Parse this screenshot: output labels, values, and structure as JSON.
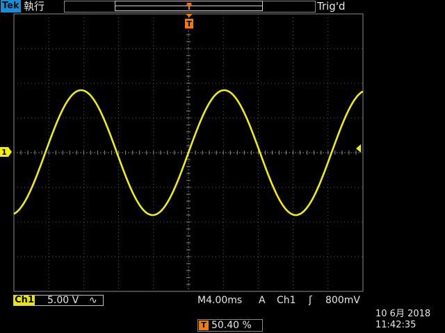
{
  "header": {
    "logo": "Tek",
    "run_status": "執行",
    "trigger_status": "Trig'd",
    "trigger_marker_top": "T",
    "trigger_marker_sub": "T"
  },
  "channel1": {
    "marker": "1",
    "label": "Ch1",
    "scale": "5.00 V",
    "coupling_icon": "∿",
    "color": "#f0f000"
  },
  "horizontal": {
    "timebase": "M4.00ms"
  },
  "trigger": {
    "mode": "A",
    "source": "Ch1",
    "slope_icon": "ʃ",
    "level": "800mV",
    "position_icon": "T",
    "position": "50.40 %",
    "marker_color": "#f07a10"
  },
  "clock": {
    "date": "10 6月  2018",
    "time": "11:42:35"
  },
  "waveform": {
    "type": "sine",
    "amplitude_divisions": 1.8,
    "period_divisions": 4.1,
    "phase_crossing_division": 5.0
  }
}
